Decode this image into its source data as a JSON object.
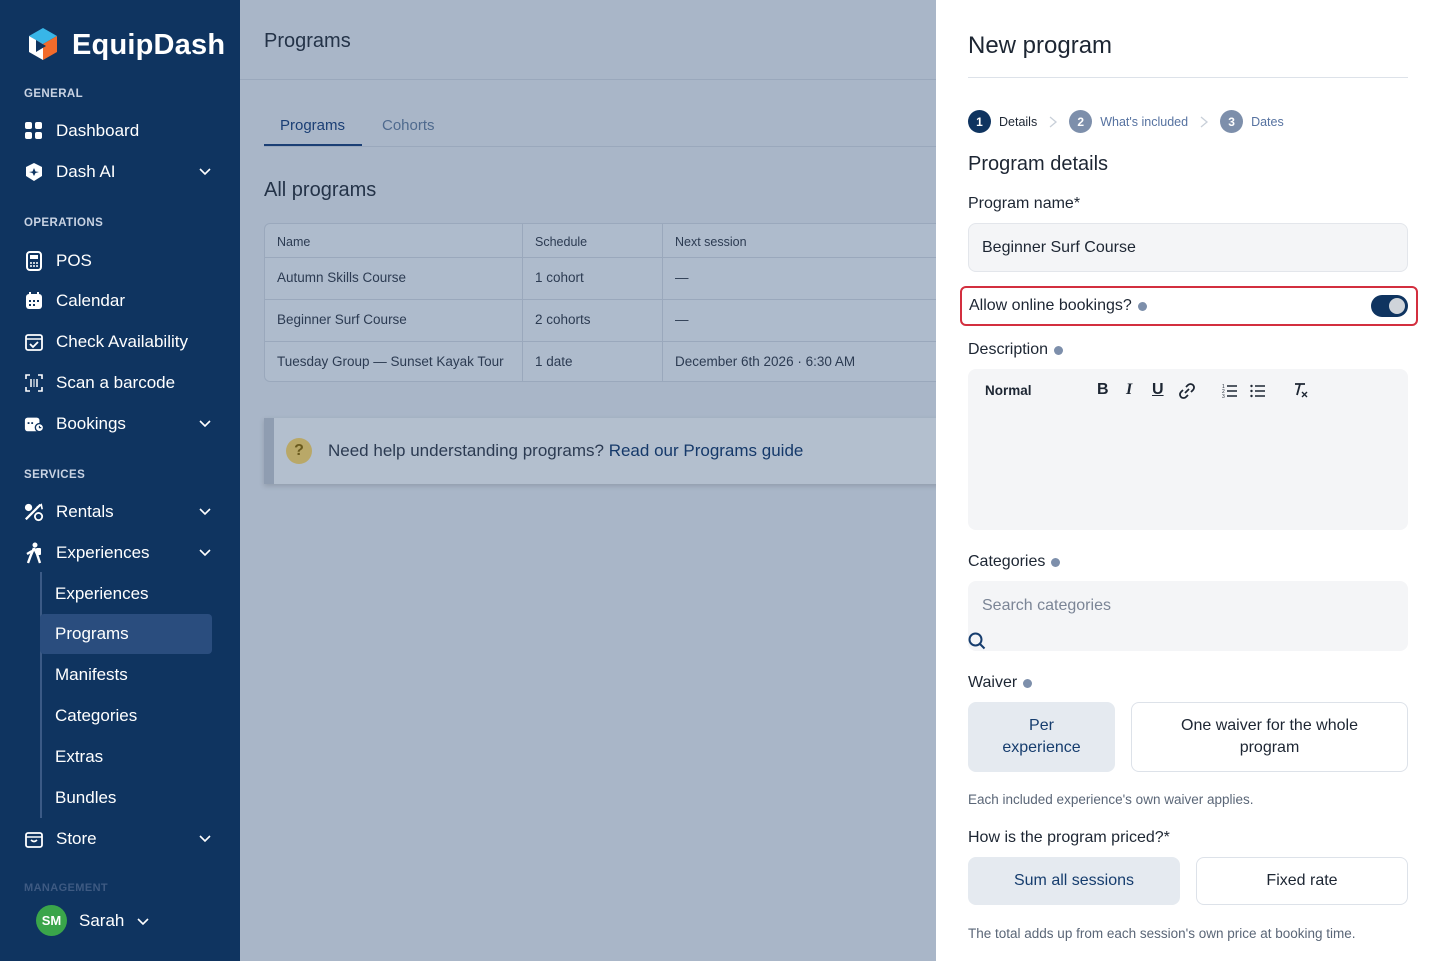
{
  "app": {
    "name": "EquipDash",
    "brand_color": "#0f3460",
    "highlight_color": "#d32f3f"
  },
  "sidebar": {
    "general_label": "GENERAL",
    "dashboard": "Dashboard",
    "dash_ai": "Dash AI",
    "operations_label": "OPERATIONS",
    "pos": "POS",
    "calendar": "Calendar",
    "check_availability": "Check Availability",
    "scan_barcode": "Scan a barcode",
    "bookings": "Bookings",
    "services_label": "SERVICES",
    "rentals": "Rentals",
    "experiences": "Experiences",
    "sub_items": [
      "Experiences",
      "Programs",
      "Manifests",
      "Categories",
      "Extras",
      "Bundles"
    ],
    "store": "Store",
    "management_label": "MANAGEMENT",
    "user_initials": "SM",
    "user_name": "Sarah"
  },
  "main": {
    "title": "Programs",
    "tabs": [
      "Programs",
      "Cohorts"
    ],
    "section_title": "All programs",
    "columns": [
      "Name",
      "Schedule",
      "Next session"
    ],
    "rows": [
      [
        "Autumn Skills Course",
        "1 cohort",
        "—"
      ],
      [
        "Beginner Surf Course",
        "2 cohorts",
        "—"
      ],
      [
        "Tuesday Group — Sunset Kayak Tour",
        "1 date",
        "December 6th 2026 · 6:30 AM"
      ]
    ],
    "help_text": "Need help understanding programs?",
    "help_link": "Read our Programs guide"
  },
  "drawer": {
    "title": "New program",
    "steps": [
      {
        "num": "1",
        "label": "Details"
      },
      {
        "num": "2",
        "label": "What's included"
      },
      {
        "num": "3",
        "label": "Dates"
      }
    ],
    "section": "Program details",
    "name_label": "Program name*",
    "name_value": "Beginner Surf Course",
    "online_label": "Allow online bookings?",
    "online_enabled": true,
    "description_label": "Description",
    "editor_style": "Normal",
    "editor_tools": [
      "B",
      "I",
      "U",
      "🔗",
      "ordered-list",
      "bullet-list",
      "clear-format"
    ],
    "categories_label": "Categories",
    "categories_placeholder": "Search categories",
    "waiver_label": "Waiver",
    "waiver_options": [
      "Per experience",
      "One waiver for the whole program"
    ],
    "waiver_hint": "Each included experience's own waiver applies.",
    "pricing_label": "How is the program priced?*",
    "pricing_options": [
      "Sum all sessions",
      "Fixed rate"
    ],
    "pricing_hint": "The total adds up from each session's own price at booking time."
  }
}
